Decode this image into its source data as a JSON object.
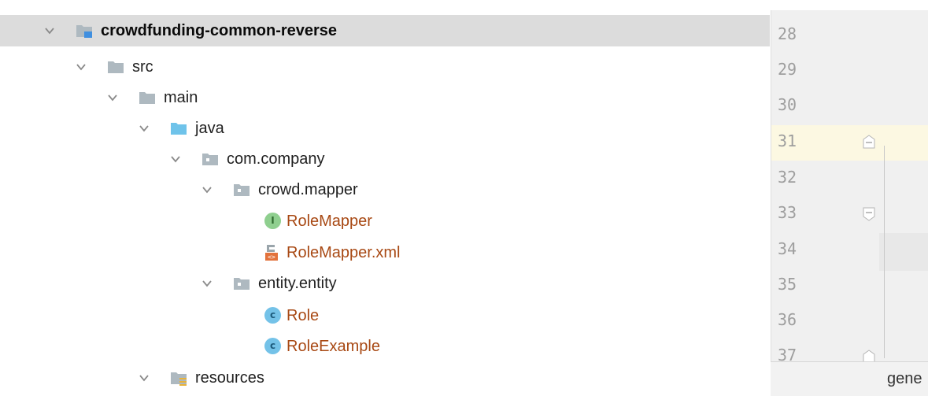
{
  "tree": {
    "items": [
      {
        "label": "crowdfunding-common-reverse",
        "kind": "module",
        "selected": true
      },
      {
        "label": "src",
        "kind": "folder"
      },
      {
        "label": "main",
        "kind": "folder"
      },
      {
        "label": "java",
        "kind": "source-root"
      },
      {
        "label": "com.company",
        "kind": "package"
      },
      {
        "label": "crowd.mapper",
        "kind": "package"
      },
      {
        "label": "RoleMapper",
        "kind": "interface",
        "icon_letter": "I"
      },
      {
        "label": "RoleMapper.xml",
        "kind": "xml-file"
      },
      {
        "label": "entity.entity",
        "kind": "package"
      },
      {
        "label": "Role",
        "kind": "class",
        "icon_letter": "c"
      },
      {
        "label": "RoleExample",
        "kind": "class",
        "icon_letter": "c"
      },
      {
        "label": "resources",
        "kind": "resources-root"
      }
    ]
  },
  "editor": {
    "line_numbers": [
      "28",
      "29",
      "30",
      "31",
      "32",
      "33",
      "34",
      "35",
      "36",
      "37"
    ],
    "current_line": "31",
    "status_text": "gene"
  },
  "colors": {
    "selection": "#dcdcdc",
    "folder": "#aeb9c0",
    "source_root": "#6fc3ea",
    "java_label": "#a84914",
    "interface_icon": "#8fcf8f",
    "class_icon": "#74c2e8",
    "xml_icon": "#e2723c",
    "current_line": "#fcf8e2"
  }
}
